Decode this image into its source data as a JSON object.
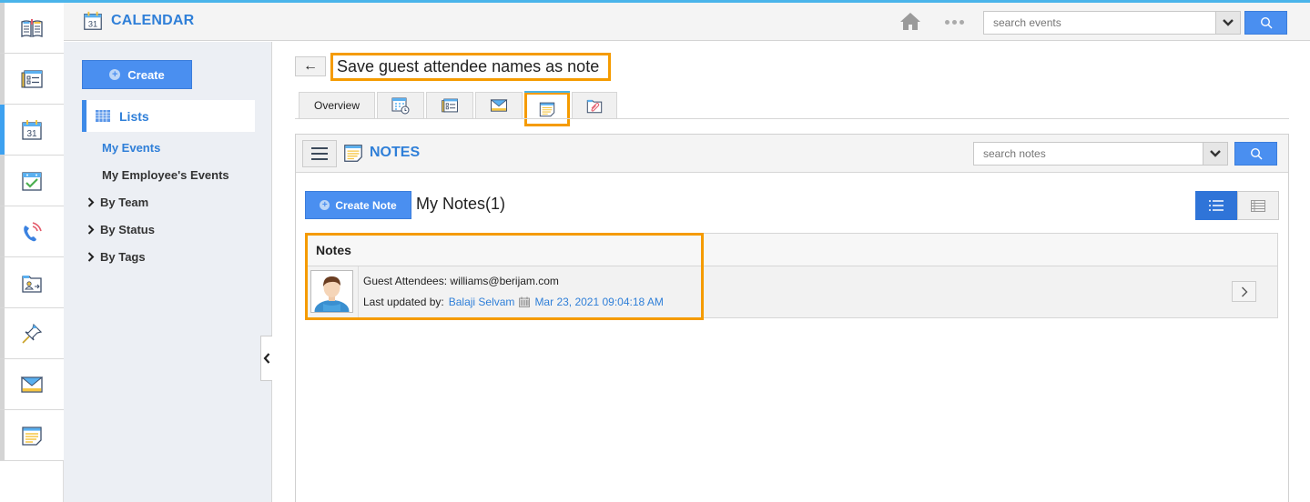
{
  "app": {
    "title": "CALENDAR",
    "accent_color": "#4ab4ea",
    "brand_blue": "#2f7fd8",
    "highlight_color": "#f59b00"
  },
  "rail": {
    "items": [
      {
        "icon": "book-icon",
        "label": "Knowledge base"
      },
      {
        "icon": "list-card-icon",
        "label": "Records"
      },
      {
        "icon": "calendar-icon",
        "label": "Calendar",
        "active": true
      },
      {
        "icon": "task-check-icon",
        "label": "Tasks"
      },
      {
        "icon": "phone-call-icon",
        "label": "Calls"
      },
      {
        "icon": "contact-folder-icon",
        "label": "Contacts"
      },
      {
        "icon": "pushpin-icon",
        "label": "Pins"
      },
      {
        "icon": "mail-icon",
        "label": "Email"
      },
      {
        "icon": "notes-icon",
        "label": "Notes"
      }
    ]
  },
  "header": {
    "search_placeholder": "search events",
    "home_icon": "home-icon",
    "more_icon": "more-dots-icon"
  },
  "sidebar": {
    "create_label": "Create",
    "lists_label": "Lists",
    "links": [
      {
        "label": "My Events",
        "active": true
      },
      {
        "label": "My Employee's Events",
        "active": false
      }
    ],
    "groups": [
      {
        "label": "By Team"
      },
      {
        "label": "By Status"
      },
      {
        "label": "By Tags"
      }
    ]
  },
  "main": {
    "back_label": "←",
    "page_title": "Save guest attendee names as note",
    "tabs": [
      {
        "label": "Overview",
        "icon": null
      },
      {
        "label": "",
        "icon": "calendar-clock-icon"
      },
      {
        "label": "",
        "icon": "list-card-icon"
      },
      {
        "label": "",
        "icon": "mail-icon"
      },
      {
        "label": "",
        "icon": "notes-icon",
        "selected": true
      },
      {
        "label": "",
        "icon": "attachment-folder-icon"
      }
    ],
    "notes": {
      "section_title": "NOTES",
      "search_placeholder": "search notes",
      "create_note_label": "Create Note",
      "count_label": "My Notes(1)",
      "table_header": "Notes",
      "rows": [
        {
          "content": "Guest Attendees: williams@berijam.com",
          "updated_prefix": "Last updated by:",
          "updated_by": "Balaji Selvam",
          "updated_at": "Mar 23, 2021 09:04:18 AM"
        }
      ]
    }
  }
}
